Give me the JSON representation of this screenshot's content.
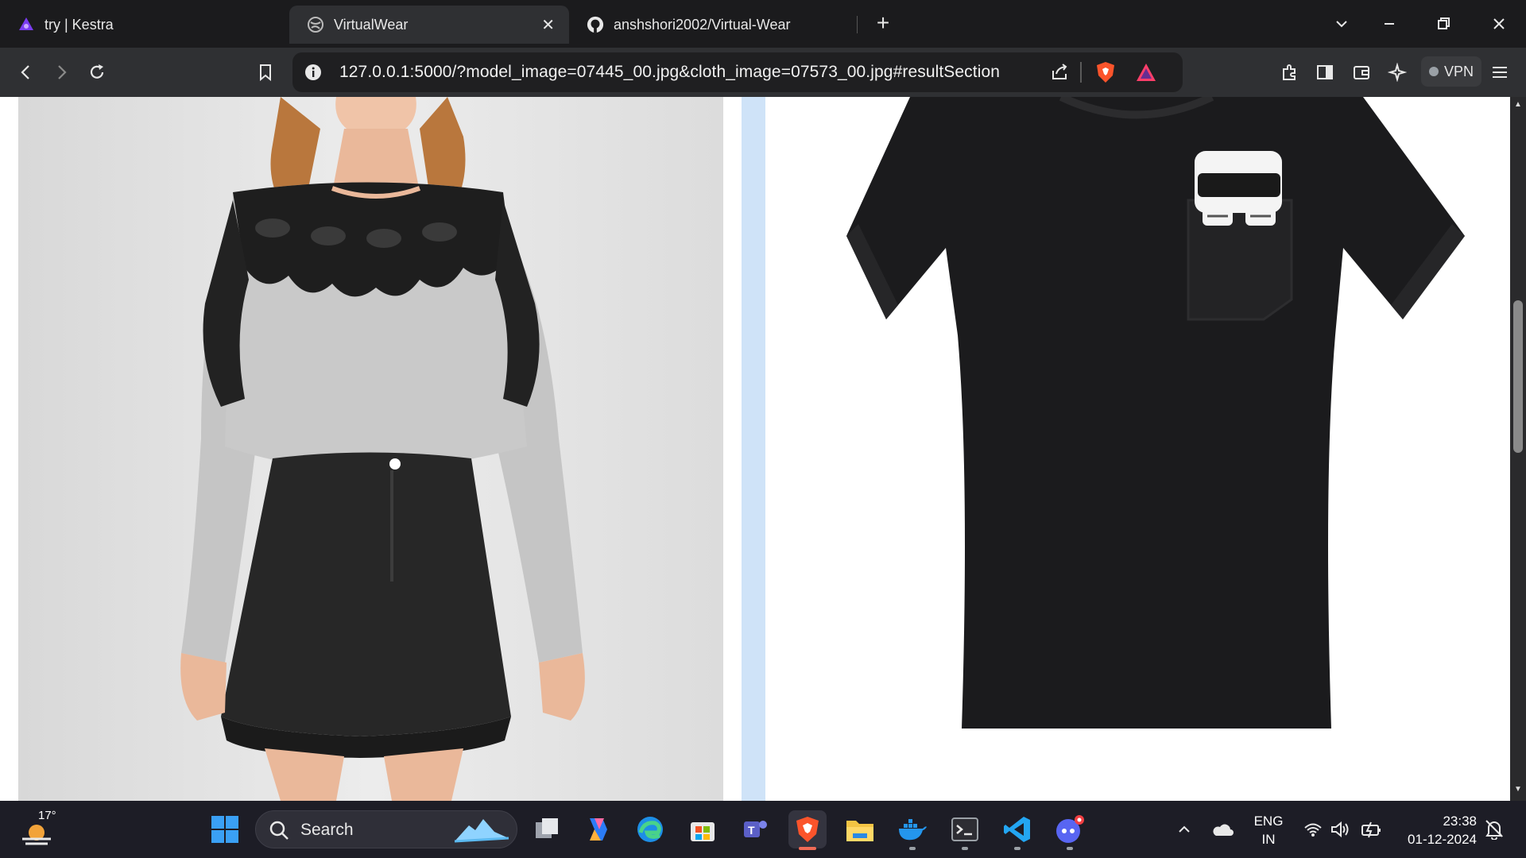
{
  "browser": {
    "tabs": [
      {
        "title": "try | Kestra",
        "icon": "kestra-icon",
        "active": false
      },
      {
        "title": "VirtualWear",
        "icon": "globe-icon",
        "active": true
      },
      {
        "title": "anshshori2002/Virtual-Wear",
        "icon": "github-icon",
        "active": false
      }
    ],
    "url": "127.0.0.1:5000/?model_image=07445_00.jpg&cloth_image=07573_00.jpg#resultSection",
    "vpn_label": "VPN"
  },
  "page": {
    "left_image": {
      "alt": "model wearing grey lace-yoke top and black denim skirt"
    },
    "right_image": {
      "alt": "black t-shirt with character pocket"
    }
  },
  "taskbar": {
    "weather_temp": "17°",
    "search_label": "Search",
    "language_line1": "ENG",
    "language_line2": "IN",
    "time": "23:38",
    "date": "01-12-2024"
  }
}
